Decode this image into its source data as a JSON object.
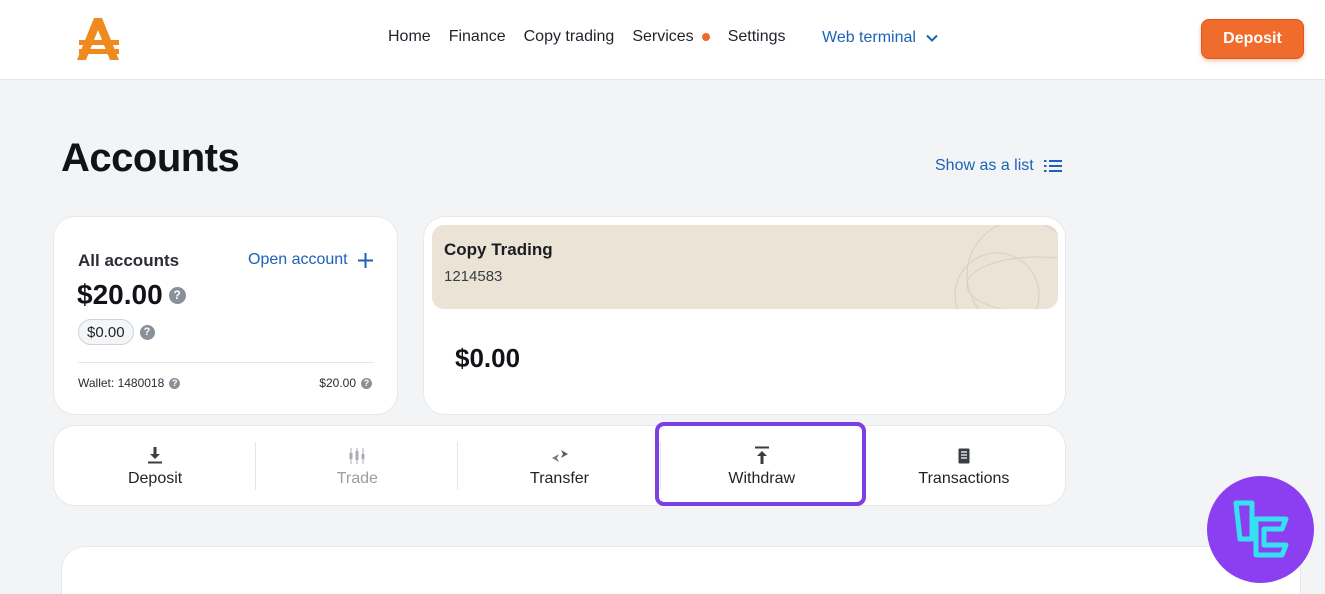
{
  "header": {
    "nav": [
      "Home",
      "Finance",
      "Copy trading",
      "Services",
      "Settings"
    ],
    "web_terminal": "Web terminal",
    "deposit_label": "Deposit"
  },
  "page": {
    "title": "Accounts",
    "show_list": "Show as a list"
  },
  "all_accounts": {
    "title": "All accounts",
    "open_account": "Open account",
    "total": "$20.00",
    "pill": "$0.00",
    "wallet_label": "Wallet: 1480018",
    "wallet_amount": "$20.00"
  },
  "copy_account": {
    "name": "Copy Trading",
    "id": "1214583",
    "balance": "$0.00"
  },
  "actions": [
    "Deposit",
    "Trade",
    "Transfer",
    "Withdraw",
    "Transactions"
  ],
  "colors": {
    "accent": "#ef6c2c",
    "link": "#1d62b8",
    "highlight": "#7b3fe4",
    "badge": "#8b3ff0",
    "banner": "#ebe3d6"
  },
  "icons": {
    "logo": "amarkets-logo-icon",
    "chevron": "chevron-down-icon",
    "list": "list-icon",
    "plus": "plus-icon",
    "help": "help-icon",
    "deposit": "download-arrow-icon",
    "trade": "candlestick-icon",
    "transfer": "transfer-arrows-icon",
    "withdraw": "upload-arrow-icon",
    "transactions": "receipt-icon",
    "badge": "tc-badge-icon"
  }
}
